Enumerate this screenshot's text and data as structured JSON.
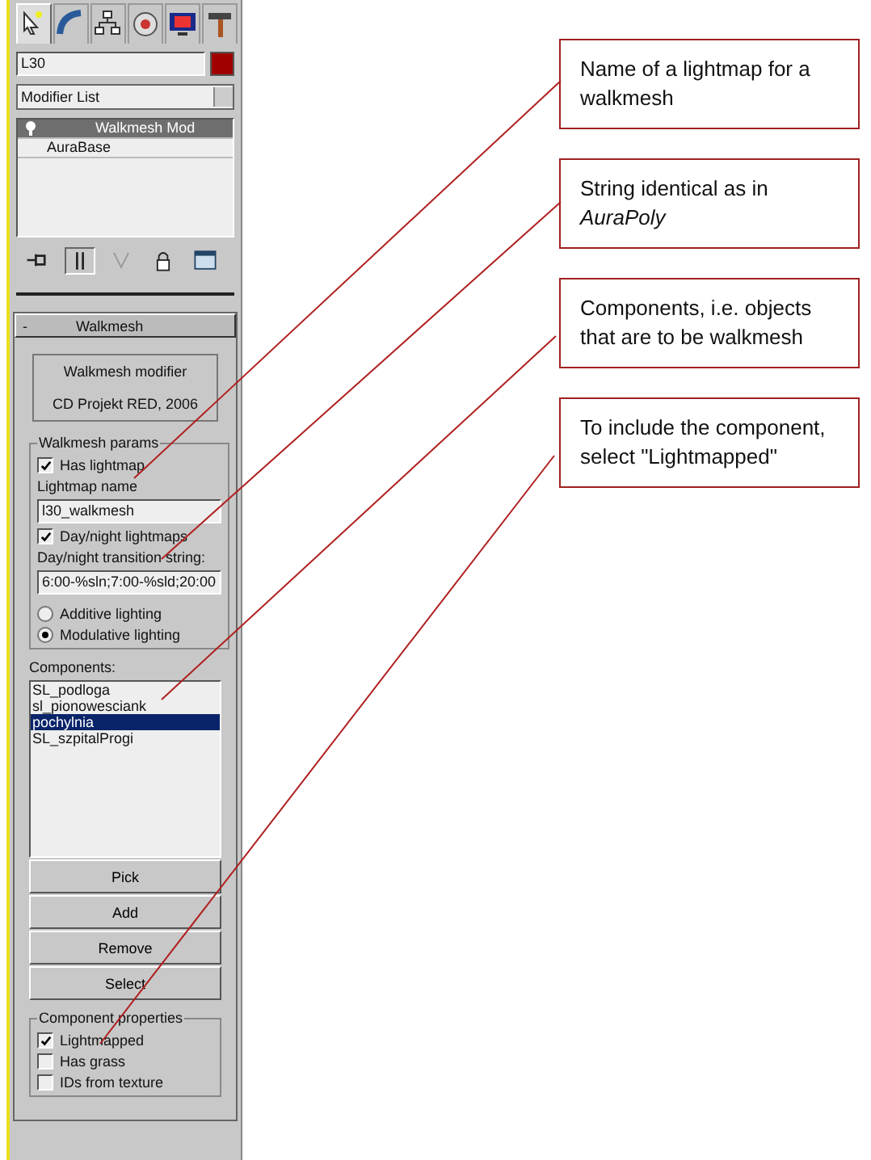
{
  "tabs": [
    {
      "selected": true
    },
    {
      "selected": false
    },
    {
      "selected": false
    },
    {
      "selected": false
    },
    {
      "selected": false
    },
    {
      "selected": false
    }
  ],
  "object": {
    "name": "L30",
    "color": "#a00000"
  },
  "modifier_list": {
    "value": "Modifier List"
  },
  "stack": [
    {
      "label": "Walkmesh Mod",
      "selected": true
    },
    {
      "label": "AuraBase",
      "selected": false
    }
  ],
  "stack_tools": [
    {
      "selected": false
    },
    {
      "selected": true
    },
    {
      "selected": false
    },
    {
      "selected": false
    },
    {
      "selected": false
    }
  ],
  "rollout": {
    "sign": "-",
    "title": "Walkmesh"
  },
  "info": [
    "Walkmesh modifier",
    "CD Projekt RED, 2006"
  ],
  "params": {
    "title": "Walkmesh params",
    "has_lightmap": {
      "label": "Has lightmap",
      "checked": true
    },
    "lightmap_name_label": "Lightmap name",
    "lightmap_name": "l30_walkmesh",
    "day_night": {
      "label": "Day/night lightmaps",
      "checked": true
    },
    "transition_label": "Day/night transition string:",
    "transition": "6:00-%sln;7:00-%sld;20:00",
    "lighting": [
      {
        "label": "Additive lighting",
        "selected": false
      },
      {
        "label": "Modulative lighting",
        "selected": true
      }
    ]
  },
  "components": {
    "label": "Components:",
    "items": [
      {
        "label": "SL_podloga",
        "selected": false
      },
      {
        "label": "sl_pionowesciank",
        "selected": false
      },
      {
        "label": "pochylnia",
        "selected": true
      },
      {
        "label": "SL_szpitalProgi",
        "selected": false
      }
    ],
    "buttons": [
      "Pick",
      "Add",
      "Remove",
      "Select"
    ]
  },
  "component_properties": {
    "title": "Component properties",
    "options": [
      {
        "label": "Lightmapped",
        "checked": true
      },
      {
        "label": "Has grass",
        "checked": false
      },
      {
        "label": "IDs from texture",
        "checked": false
      }
    ]
  },
  "callouts": [
    {
      "text": "Name of a lightmap for a walkmesh"
    },
    {
      "text": "String identical as in *AuraPoly*"
    },
    {
      "text": "Components, i.e. objects that are to be walkmesh"
    },
    {
      "text": "To include the component, select \"Lightmapped\""
    }
  ]
}
